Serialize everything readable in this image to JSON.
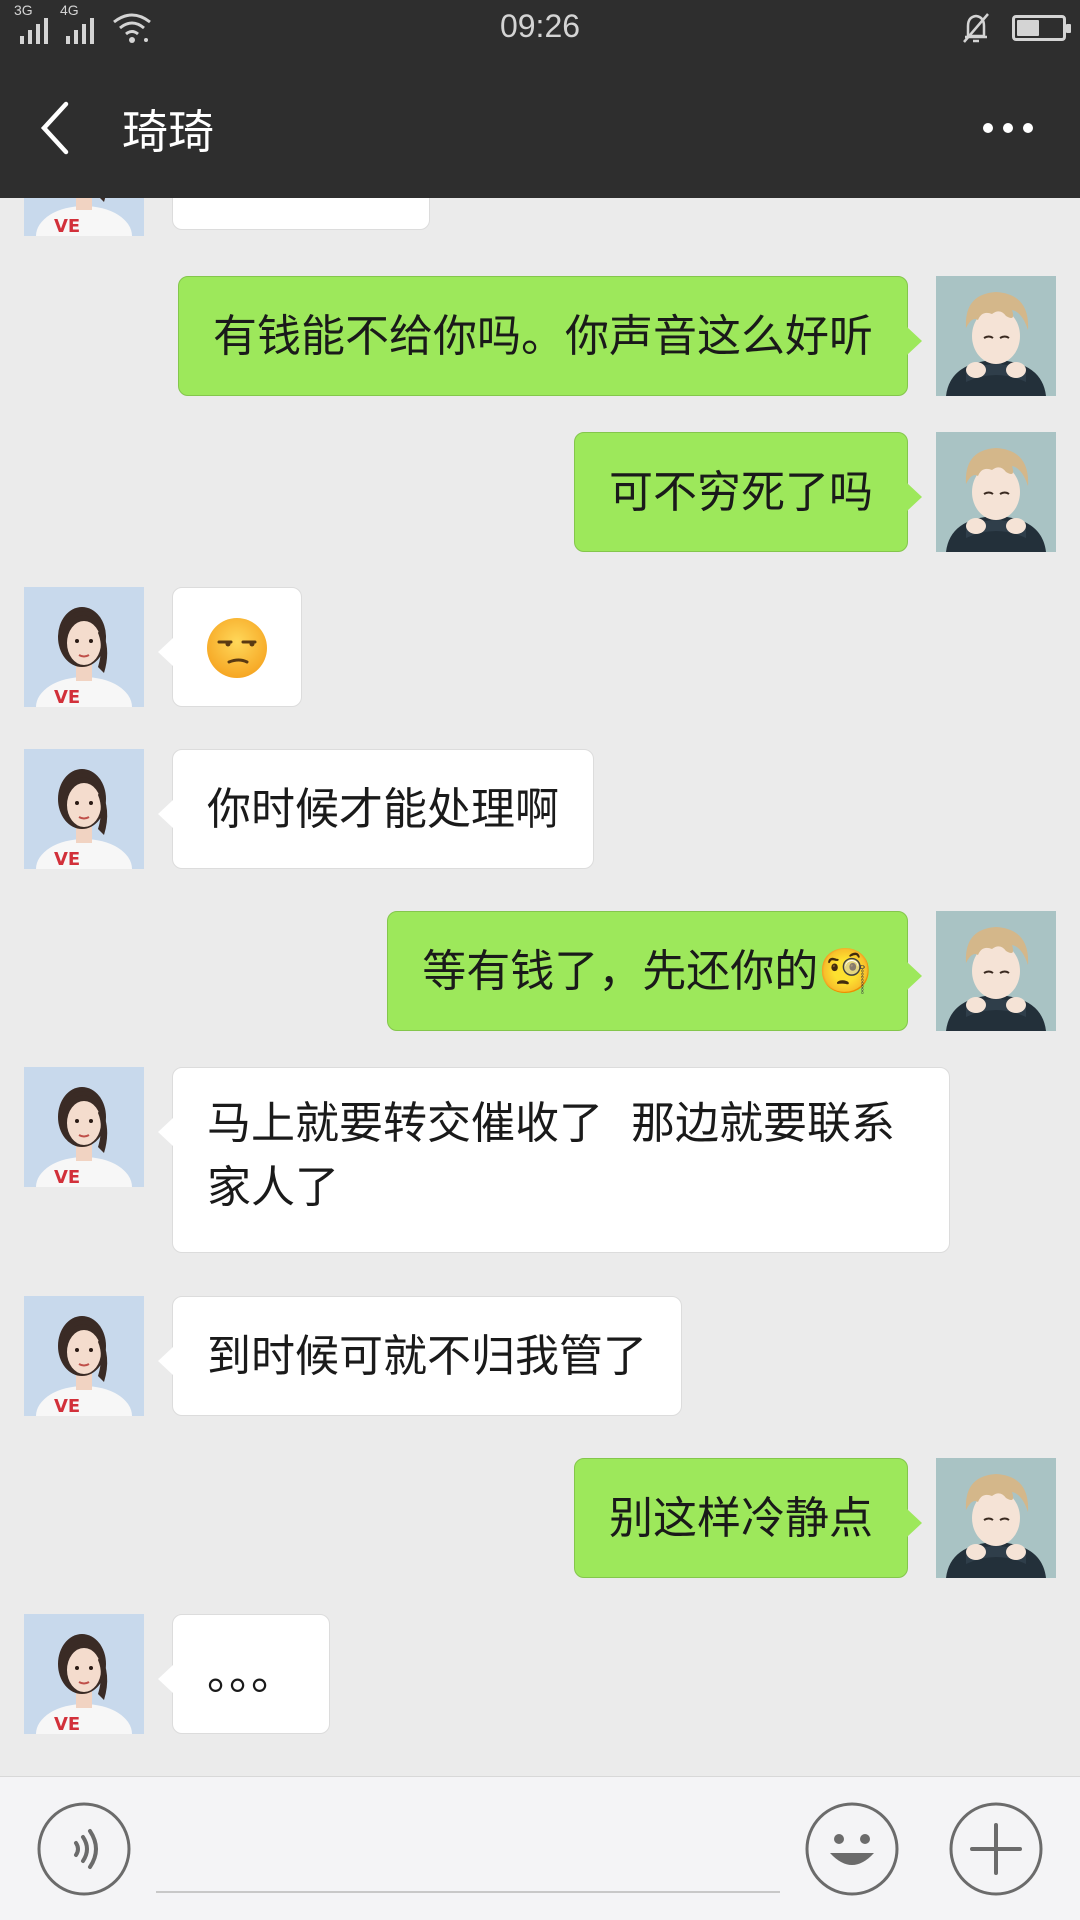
{
  "status_bar": {
    "time": "09:26",
    "network_1": "3G",
    "network_2": "4G",
    "battery_level": 0.5
  },
  "header": {
    "title": "琦琦",
    "back_icon": "chevron-left-icon",
    "more_icon": "more-horizontal-icon"
  },
  "colors": {
    "header_bg": "#2e2e2e",
    "chat_bg": "#ebebeb",
    "outgoing_bubble": "#9de85b",
    "incoming_bubble": "#ffffff"
  },
  "messages": [
    {
      "side": "in",
      "text": ""
    },
    {
      "side": "out",
      "text": "有钱能不给你吗。你声音这么好听"
    },
    {
      "side": "out",
      "text": "可不穷死了吗"
    },
    {
      "side": "in",
      "text": "😒"
    },
    {
      "side": "in",
      "text": "你时候才能处理啊"
    },
    {
      "side": "out",
      "text": "等有钱了，先还你的🧐"
    },
    {
      "side": "in",
      "text": "马上就要转交催收了  那边就要联系家人了"
    },
    {
      "side": "in",
      "text": "到时候可就不归我管了"
    },
    {
      "side": "out",
      "text": "别这样冷静点"
    },
    {
      "side": "in",
      "text": "。。。"
    }
  ],
  "input_bar": {
    "voice_icon": "voice-icon",
    "emoji_icon": "emoji-icon",
    "plus_icon": "plus-icon",
    "text_value": ""
  }
}
